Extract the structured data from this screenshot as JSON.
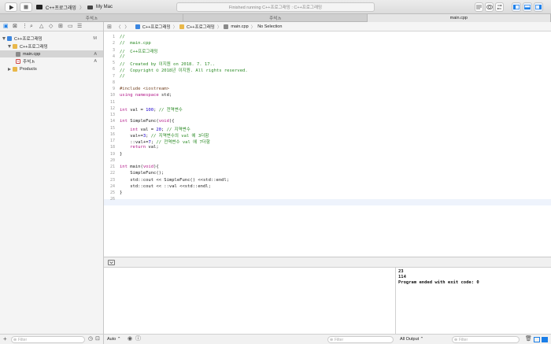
{
  "toolbar": {
    "scheme_target": "C++프로그래밍",
    "scheme_device": "My Mac",
    "status_text": "Finished running C++프로그래밍 : C++프로그래밍"
  },
  "tabs": [
    {
      "label": "주석.h",
      "active": false
    },
    {
      "label": "주석.h",
      "active": false
    },
    {
      "label": "main.cpp",
      "active": true
    }
  ],
  "navigator": {
    "project": {
      "label": "C++프로그래밍",
      "status": "M"
    },
    "group": {
      "label": "C++프로그래밍"
    },
    "files": [
      {
        "label": "main.cpp",
        "status": "A",
        "selected": true
      },
      {
        "label": "주석.h",
        "status": "A",
        "selected": false
      }
    ],
    "products": {
      "label": "Products"
    },
    "filter_placeholder": "Filter"
  },
  "jumpbar": {
    "project": "C++프로그래밍",
    "group": "C++프로그래밍",
    "file": "main.cpp",
    "selection": "No Selection"
  },
  "editor": {
    "lines": [
      "//",
      "//  main.cpp",
      "//  C++프로그래밍",
      "//",
      "//  Created by 이지원 on 2018. 7. 17..",
      "//  Copyright © 2018년 이지원. All rights reserved.",
      "//",
      "",
      "#include <iostream>",
      "using namespace std;",
      "",
      "int val = 100; // 전역변수",
      "",
      "int SimpleFunc(void){",
      "    int val = 20; // 지역변수",
      "    val+=3; // 지역변수의 val 에 3더함",
      "    ::val+=7; // 전역변수 val 에 7더함",
      "    return val;",
      "}",
      "",
      "int main(void){",
      "    SimpleFunc();",
      "    std::cout << SimpleFunc() <<std::endl;",
      "    std::cout << ::val <<std::endl;",
      "}",
      ""
    ]
  },
  "debug": {
    "variables_scope": "Auto",
    "variables_filter_placeholder": "Filter",
    "console_scope": "All Output",
    "console_filter_placeholder": "Filter",
    "console_lines": [
      "23",
      "114",
      "Program ended with exit code: 0"
    ]
  },
  "colors": {
    "comment": "#2a8a24",
    "keyword": "#b21889",
    "preprocessor": "#78492a",
    "number": "#1c00cf",
    "accent": "#1a7ee8"
  }
}
